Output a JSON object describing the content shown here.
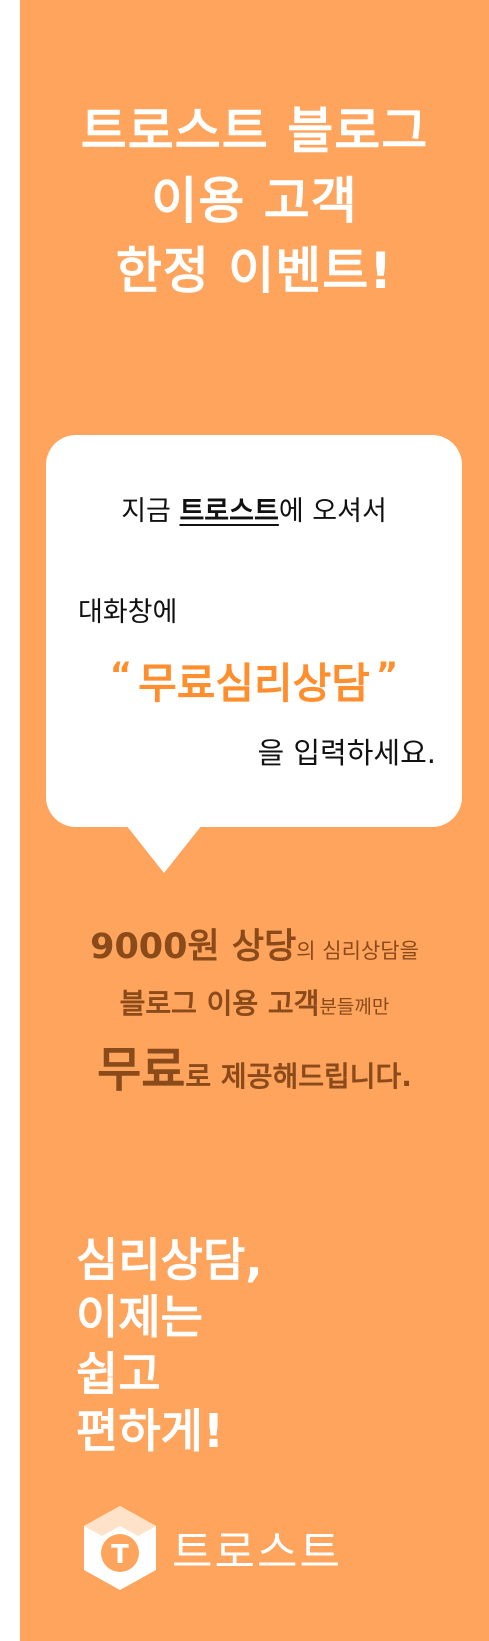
{
  "headline": {
    "line1": "트로스트 블로그",
    "line2": "이용 고객",
    "line3": "한정 이벤트!"
  },
  "bubble": {
    "line1_prefix": "지금 ",
    "line1_brand": "트로스트",
    "line1_suffix": "에 오셔서",
    "line2": "대화창에",
    "quote_open": "“",
    "keyword": "무료심리상담",
    "quote_close": "”",
    "line4": "을 입력하세요."
  },
  "offer": {
    "line1_big": "9000원 상당",
    "line1_rest": "의 심리상담을",
    "line2_big": "블로그 이용 고객",
    "line2_rest": "분들께만",
    "line3_big": "무료",
    "line3_rest": "로 제공해드립니다."
  },
  "slogan": {
    "line1": "심리상담,",
    "line2": "이제는",
    "line3": "쉽고",
    "line4": "편하게!"
  },
  "logo": {
    "icon": "trost-logo-icon",
    "icon_letter": "T",
    "text": "트로스트"
  },
  "colors": {
    "background": "#ffa45c",
    "accent": "#ff8f2e",
    "offer_text": "#8a4a1a",
    "white": "#ffffff"
  }
}
